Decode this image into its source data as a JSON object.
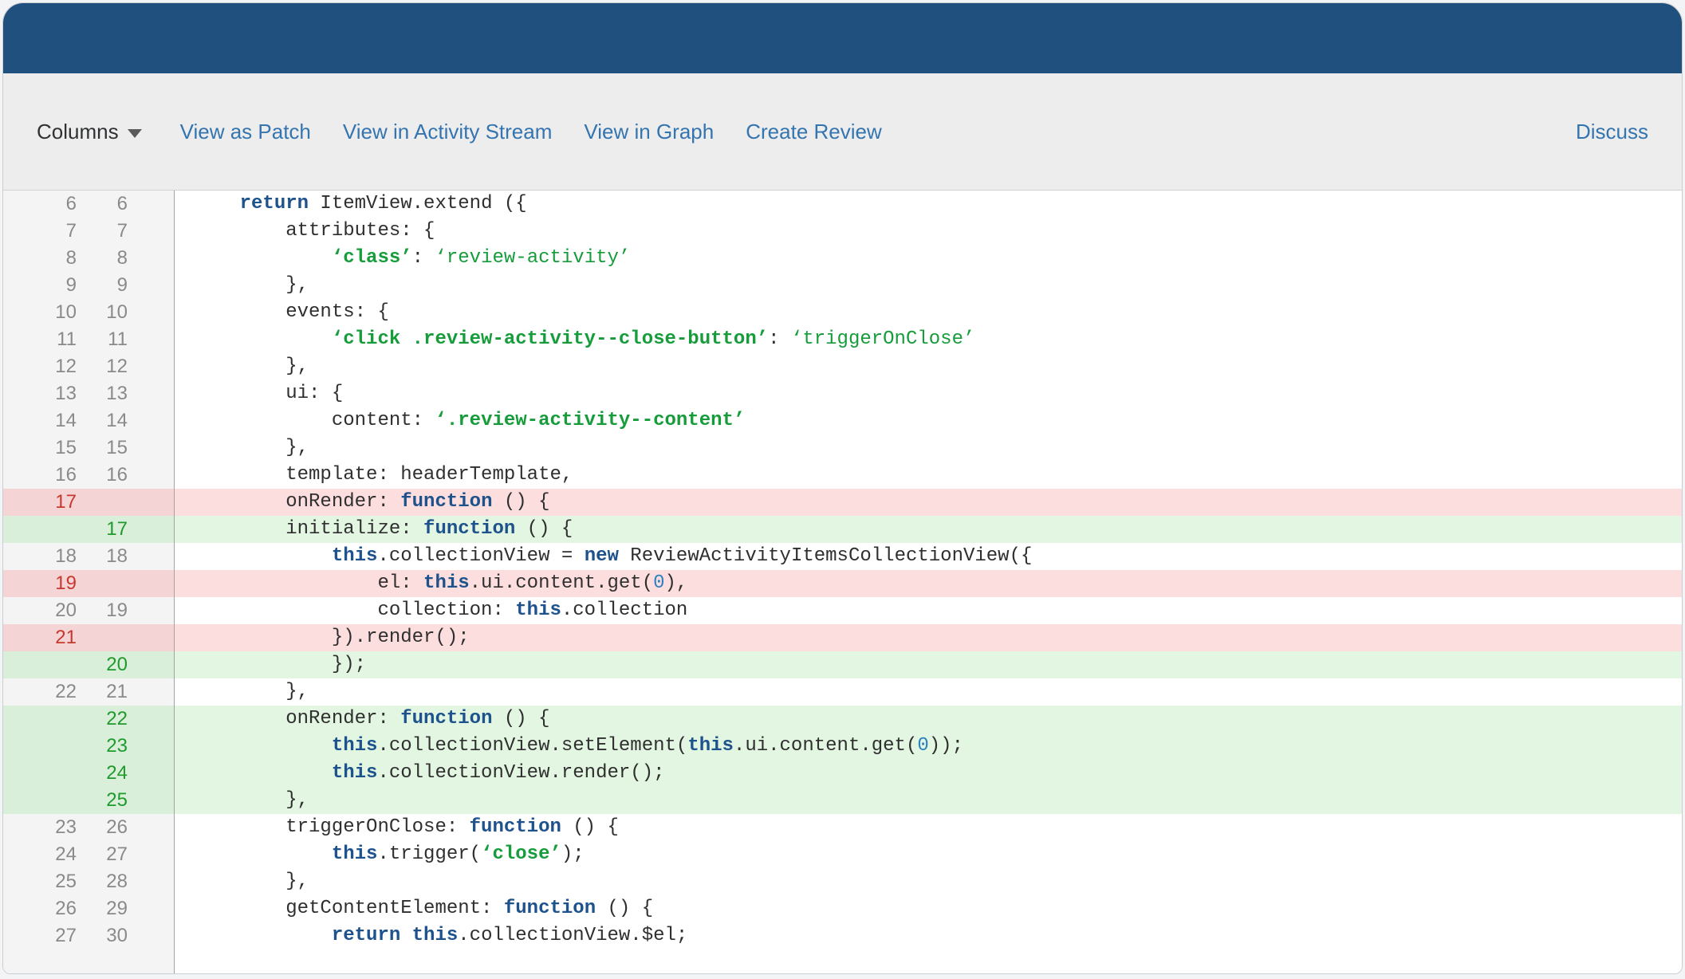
{
  "toolbar": {
    "columns_label": "Columns",
    "links": [
      "View as Patch",
      "View in Activity Stream",
      "View in Graph",
      "Create Review"
    ],
    "discuss_label": "Discuss"
  },
  "colors": {
    "header_blue": "#20507e",
    "toolbar_bg": "#ededee",
    "link_blue": "#3474af",
    "gutter_bg": "#f4f4f4",
    "line_number_gray": "#8a8a8a",
    "removed_row_bg": "#fcdede",
    "removed_gutter_bg": "#f4d4d4",
    "removed_number": "#c7382e",
    "added_row_bg": "#e2f6e2",
    "added_gutter_bg": "#d9efd9",
    "added_number": "#1f9a2d",
    "keyword_blue": "#1d528c",
    "string_green": "#169c3a",
    "number_literal_blue": "#2e80c0"
  },
  "diff": {
    "rows": [
      {
        "old": "6",
        "new": "6",
        "type": "ctx",
        "indent": 4,
        "tokens": [
          {
            "text": "return",
            "style": "keyword"
          },
          {
            "text": " ItemView.extend ({",
            "style": "plain"
          }
        ]
      },
      {
        "old": "7",
        "new": "7",
        "type": "ctx",
        "indent": 8,
        "tokens": [
          {
            "text": "attributes: {",
            "style": "plain"
          }
        ]
      },
      {
        "old": "8",
        "new": "8",
        "type": "ctx",
        "indent": 12,
        "tokens": [
          {
            "text": "‘class’",
            "style": "string-bold"
          },
          {
            "text": ": ",
            "style": "plain"
          },
          {
            "text": "‘review-activity’",
            "style": "string"
          }
        ]
      },
      {
        "old": "9",
        "new": "9",
        "type": "ctx",
        "indent": 8,
        "tokens": [
          {
            "text": "},",
            "style": "plain"
          }
        ]
      },
      {
        "old": "10",
        "new": "10",
        "type": "ctx",
        "indent": 8,
        "tokens": [
          {
            "text": "events: {",
            "style": "plain"
          }
        ]
      },
      {
        "old": "11",
        "new": "11",
        "type": "ctx",
        "indent": 12,
        "tokens": [
          {
            "text": "‘click .review-activity--close-button’",
            "style": "string-bold"
          },
          {
            "text": ": ",
            "style": "plain"
          },
          {
            "text": "‘triggerOnClose’",
            "style": "string"
          }
        ]
      },
      {
        "old": "12",
        "new": "12",
        "type": "ctx",
        "indent": 8,
        "tokens": [
          {
            "text": "},",
            "style": "plain"
          }
        ]
      },
      {
        "old": "13",
        "new": "13",
        "type": "ctx",
        "indent": 8,
        "tokens": [
          {
            "text": "ui: {",
            "style": "plain"
          }
        ]
      },
      {
        "old": "14",
        "new": "14",
        "type": "ctx",
        "indent": 12,
        "tokens": [
          {
            "text": "content: ",
            "style": "plain"
          },
          {
            "text": "‘.review-activity--content’",
            "style": "string-bold"
          }
        ]
      },
      {
        "old": "15",
        "new": "15",
        "type": "ctx",
        "indent": 8,
        "tokens": [
          {
            "text": "},",
            "style": "plain"
          }
        ]
      },
      {
        "old": "16",
        "new": "16",
        "type": "ctx",
        "indent": 8,
        "tokens": [
          {
            "text": "template: headerTemplate,",
            "style": "plain"
          }
        ]
      },
      {
        "old": "17",
        "new": "",
        "type": "del",
        "indent": 8,
        "tokens": [
          {
            "text": "onRender: ",
            "style": "plain"
          },
          {
            "text": "function",
            "style": "keyword"
          },
          {
            "text": " () {",
            "style": "plain"
          }
        ]
      },
      {
        "old": "",
        "new": "17",
        "type": "add",
        "indent": 8,
        "tokens": [
          {
            "text": "initialize: ",
            "style": "plain"
          },
          {
            "text": "function",
            "style": "keyword"
          },
          {
            "text": " () {",
            "style": "plain"
          }
        ]
      },
      {
        "old": "18",
        "new": "18",
        "type": "ctx",
        "indent": 12,
        "tokens": [
          {
            "text": "this",
            "style": "keyword"
          },
          {
            "text": ".collectionView = ",
            "style": "plain"
          },
          {
            "text": "new",
            "style": "keyword"
          },
          {
            "text": " ReviewActivityItemsCollectionView({",
            "style": "plain"
          }
        ]
      },
      {
        "old": "19",
        "new": "",
        "type": "del",
        "indent": 16,
        "tokens": [
          {
            "text": "el: ",
            "style": "plain"
          },
          {
            "text": "this",
            "style": "keyword"
          },
          {
            "text": ".ui.content.get(",
            "style": "plain"
          },
          {
            "text": "0",
            "style": "number"
          },
          {
            "text": "),",
            "style": "plain"
          }
        ]
      },
      {
        "old": "20",
        "new": "19",
        "type": "ctx",
        "indent": 16,
        "tokens": [
          {
            "text": "collection: ",
            "style": "plain"
          },
          {
            "text": "this",
            "style": "keyword"
          },
          {
            "text": ".collection",
            "style": "plain"
          }
        ]
      },
      {
        "old": "21",
        "new": "",
        "type": "del",
        "indent": 12,
        "tokens": [
          {
            "text": "}).render();",
            "style": "plain"
          }
        ]
      },
      {
        "old": "",
        "new": "20",
        "type": "add",
        "indent": 12,
        "tokens": [
          {
            "text": "});",
            "style": "plain"
          }
        ]
      },
      {
        "old": "22",
        "new": "21",
        "type": "ctx",
        "indent": 8,
        "tokens": [
          {
            "text": "},",
            "style": "plain"
          }
        ]
      },
      {
        "old": "",
        "new": "22",
        "type": "add",
        "indent": 8,
        "tokens": [
          {
            "text": "onRender: ",
            "style": "plain"
          },
          {
            "text": "function",
            "style": "keyword"
          },
          {
            "text": " () {",
            "style": "plain"
          }
        ]
      },
      {
        "old": "",
        "new": "23",
        "type": "add",
        "indent": 12,
        "tokens": [
          {
            "text": "this",
            "style": "keyword"
          },
          {
            "text": ".collectionView.setElement(",
            "style": "plain"
          },
          {
            "text": "this",
            "style": "keyword"
          },
          {
            "text": ".ui.content.get(",
            "style": "plain"
          },
          {
            "text": "0",
            "style": "number"
          },
          {
            "text": "));",
            "style": "plain"
          }
        ]
      },
      {
        "old": "",
        "new": "24",
        "type": "add",
        "indent": 12,
        "tokens": [
          {
            "text": "this",
            "style": "keyword"
          },
          {
            "text": ".collectionView.render();",
            "style": "plain"
          }
        ]
      },
      {
        "old": "",
        "new": "25",
        "type": "add",
        "indent": 8,
        "tokens": [
          {
            "text": "},",
            "style": "plain"
          }
        ]
      },
      {
        "old": "23",
        "new": "26",
        "type": "ctx",
        "indent": 8,
        "tokens": [
          {
            "text": "triggerOnClose: ",
            "style": "plain"
          },
          {
            "text": "function",
            "style": "keyword"
          },
          {
            "text": " () {",
            "style": "plain"
          }
        ]
      },
      {
        "old": "24",
        "new": "27",
        "type": "ctx",
        "indent": 12,
        "tokens": [
          {
            "text": "this",
            "style": "keyword"
          },
          {
            "text": ".trigger(",
            "style": "plain"
          },
          {
            "text": "‘close’",
            "style": "string-bold"
          },
          {
            "text": ");",
            "style": "plain"
          }
        ]
      },
      {
        "old": "25",
        "new": "28",
        "type": "ctx",
        "indent": 8,
        "tokens": [
          {
            "text": "},",
            "style": "plain"
          }
        ]
      },
      {
        "old": "26",
        "new": "29",
        "type": "ctx",
        "indent": 8,
        "tokens": [
          {
            "text": "getContentElement: ",
            "style": "plain"
          },
          {
            "text": "function",
            "style": "keyword"
          },
          {
            "text": " () {",
            "style": "plain"
          }
        ]
      },
      {
        "old": "27",
        "new": "30",
        "type": "ctx",
        "indent": 12,
        "tokens": [
          {
            "text": "return",
            "style": "keyword"
          },
          {
            "text": " ",
            "style": "plain"
          },
          {
            "text": "this",
            "style": "keyword"
          },
          {
            "text": ".collectionView.$el;",
            "style": "plain"
          }
        ]
      }
    ]
  }
}
